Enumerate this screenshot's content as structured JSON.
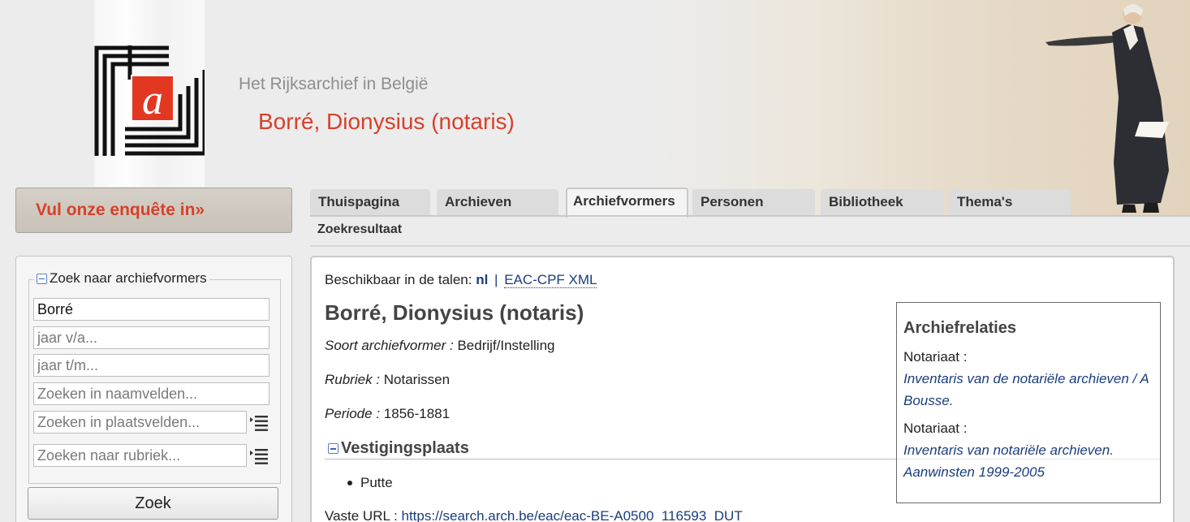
{
  "header": {
    "site_name": "Het Rijksarchief in België",
    "page_heading": "Borré, Dionysius (notaris)"
  },
  "survey": {
    "label": "Vul onze enquête in»"
  },
  "tabs": [
    {
      "label": "Thuispagina"
    },
    {
      "label": "Archieven"
    },
    {
      "label": "Archiefvormers",
      "active": true
    },
    {
      "label": "Personen"
    },
    {
      "label": "Bibliotheek"
    },
    {
      "label": "Thema's"
    }
  ],
  "subtab": {
    "label": "Zoekresultaat"
  },
  "search": {
    "legend": "Zoek naar archiefvormers",
    "name_value": "Borré",
    "year_from_placeholder": "jaar v/a...",
    "year_to_placeholder": "jaar t/m...",
    "name_fields_placeholder": "Zoeken in naamvelden...",
    "place_fields_placeholder": "Zoeken in plaatsvelden...",
    "category_placeholder": "Zoeken naar rubriek...",
    "button_label": "Zoek"
  },
  "content": {
    "languages_label": "Beschikbaar in de talen:",
    "language_nl": "nl",
    "separator": "|",
    "eac_link": "EAC-CPF XML",
    "title": "Borré, Dionysius (notaris)",
    "type_label": "Soort archiefvormer :",
    "type_value": "Bedrijf/Instelling",
    "category_label": "Rubriek :",
    "category_value": "Notarissen",
    "period_label": "Periode :",
    "period_value": "1856-1881",
    "location_heading": "Vestigingsplaats",
    "location_item": "Putte",
    "url_label": "Vaste URL :",
    "url_value": "https://search.arch.be/eac/eac-BE-A0500_116593_DUT"
  },
  "relations": {
    "title": "Archiefrelaties",
    "items": [
      {
        "type": "Notariaat :",
        "link": "Inventaris van de notariële archieven / A Bousse."
      },
      {
        "type": "Notariaat :",
        "link": "Inventaris van notariële archieven. Aanwinsten 1999-2005"
      }
    ]
  },
  "colors": {
    "brand_red": "#d8402b",
    "link_blue": "#1a3d7c"
  }
}
